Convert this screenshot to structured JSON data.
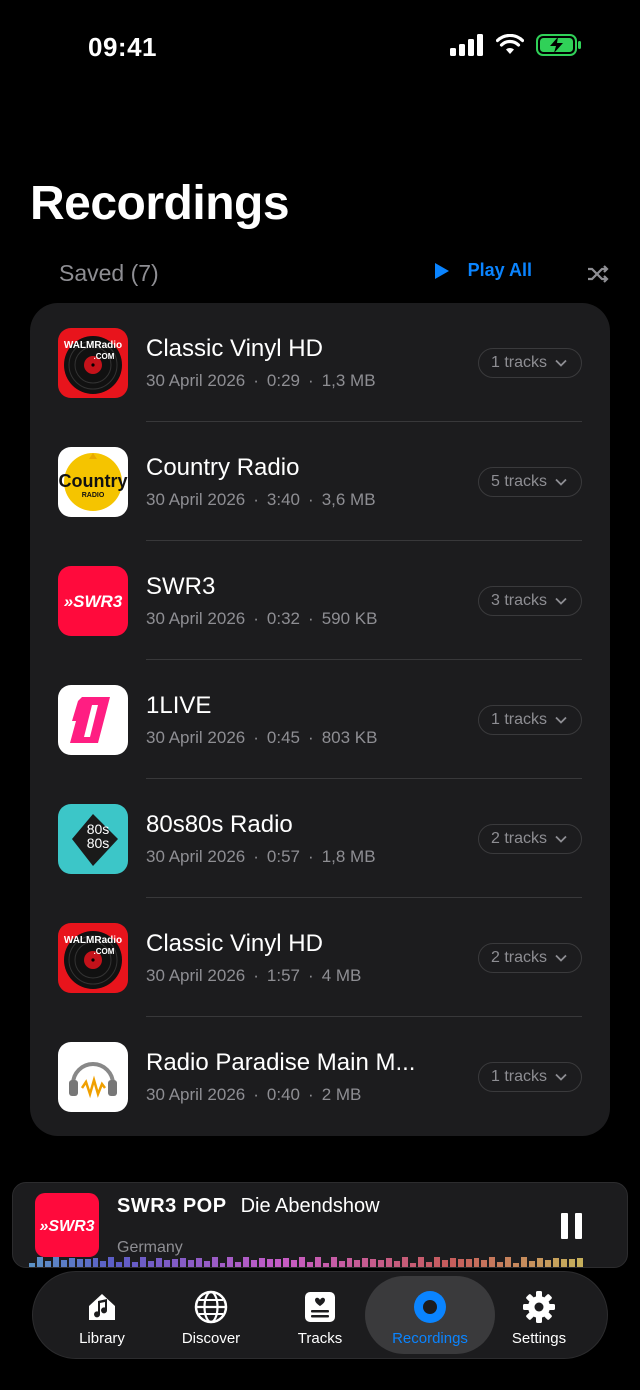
{
  "status_bar": {
    "time": "09:41"
  },
  "page": {
    "title": "Recordings"
  },
  "section": {
    "saved_label": "Saved (7)",
    "play_all_label": "Play All"
  },
  "recordings": [
    {
      "title": "Classic Vinyl HD",
      "date": "30 April 2026",
      "duration": "0:29",
      "size": "1,3 MB",
      "tracks": "1 tracks",
      "logo": "walm-radio-logo"
    },
    {
      "title": "Country Radio",
      "date": "30 April 2026",
      "duration": "3:40",
      "size": "3,6 MB",
      "tracks": "5 tracks",
      "logo": "country-radio-logo"
    },
    {
      "title": "SWR3",
      "date": "30 April 2026",
      "duration": "0:32",
      "size": "590 KB",
      "tracks": "3 tracks",
      "logo": "swr3-logo"
    },
    {
      "title": "1LIVE",
      "date": "30 April 2026",
      "duration": "0:45",
      "size": "803 KB",
      "tracks": "1 tracks",
      "logo": "1live-logo"
    },
    {
      "title": "80s80s Radio",
      "date": "30 April 2026",
      "duration": "0:57",
      "size": "1,8 MB",
      "tracks": "2 tracks",
      "logo": "80s80s-logo"
    },
    {
      "title": "Classic Vinyl HD",
      "date": "30 April 2026",
      "duration": "1:57",
      "size": "4 MB",
      "tracks": "2 tracks",
      "logo": "walm-radio-logo"
    },
    {
      "title": "Radio Paradise Main M...",
      "date": "30 April 2026",
      "duration": "0:40",
      "size": "2 MB",
      "tracks": "1 tracks",
      "logo": "radio-paradise-logo"
    }
  ],
  "logo_text": {
    "walm": "WALMRadio",
    "walm_sub": ".COM",
    "country": "Country",
    "country_sub": "RADIO",
    "swr3": "»SWR3",
    "onelive": "1",
    "eighties_top": "80s",
    "eighties_bottom": "80s"
  },
  "mini_player": {
    "station": "SWR3 POP",
    "show": "Die Abendshow",
    "country": "Germany"
  },
  "tabs": [
    {
      "label": "Library",
      "icon": "house-music-icon"
    },
    {
      "label": "Discover",
      "icon": "globe-icon"
    },
    {
      "label": "Tracks",
      "icon": "tracks-list-icon"
    },
    {
      "label": "Recordings",
      "icon": "record-icon",
      "active": true
    },
    {
      "label": "Settings",
      "icon": "gear-icon"
    }
  ],
  "colors": {
    "accent": "#0a84ff",
    "background": "#000000",
    "card": "#1c1c1e",
    "secondary_text": "#8e8e93",
    "battery": "#30d158",
    "swr3_red": "#ff0a3c",
    "onelive_pink": "#ff1e82",
    "eighties_teal": "#3cc6c8"
  }
}
